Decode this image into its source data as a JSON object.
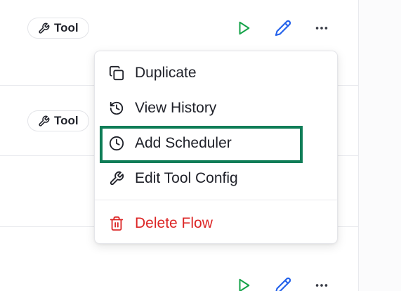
{
  "rows": [
    {
      "tag_label": "Tool"
    },
    {
      "tag_label": "Tool"
    }
  ],
  "icons": {
    "tool": "wrench-icon",
    "run": "play-icon",
    "edit": "pencil-icon",
    "more": "more-horizontal-icon"
  },
  "menu": {
    "items": [
      {
        "label": "Duplicate",
        "icon": "copy-icon"
      },
      {
        "label": "View History",
        "icon": "history-icon"
      },
      {
        "label": "Add Scheduler",
        "icon": "clock-icon"
      },
      {
        "label": "Edit Tool Config",
        "icon": "wrench-icon"
      },
      {
        "label": "Delete Flow",
        "icon": "trash-icon",
        "danger": true
      }
    ]
  },
  "colors": {
    "play": "#16a34a",
    "edit": "#2563eb",
    "danger": "#dc2626",
    "highlight": "#0f7d57",
    "text": "#1f2129"
  }
}
